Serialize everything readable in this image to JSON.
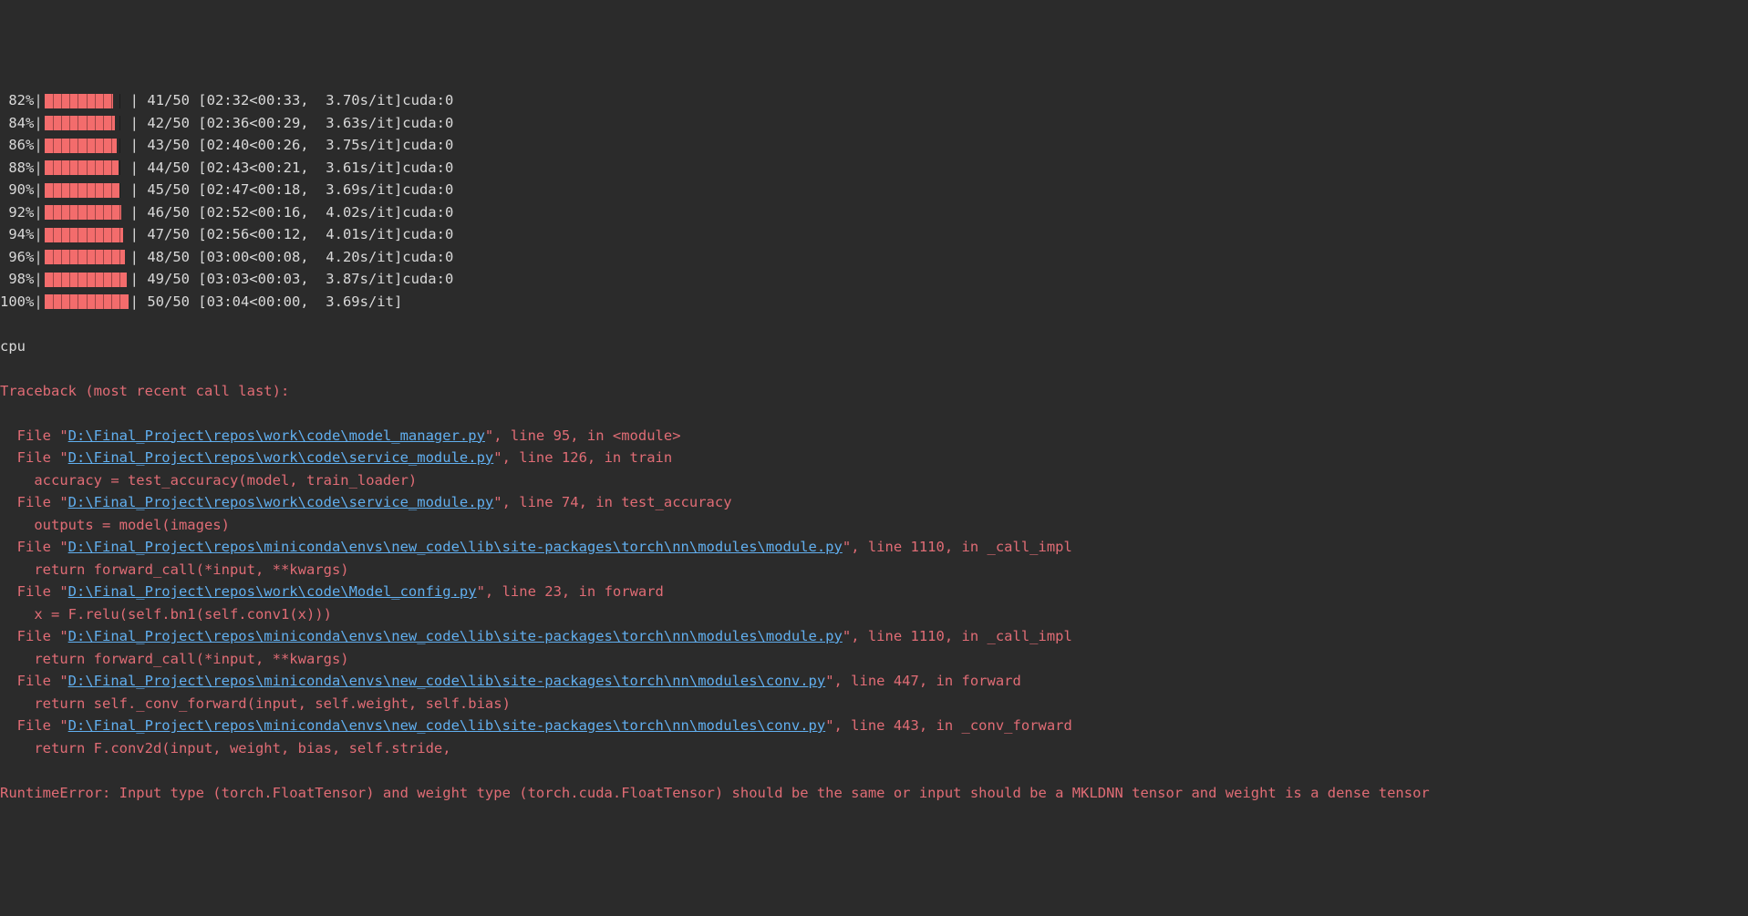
{
  "bar": {
    "ticks": 10
  },
  "progress": [
    {
      "pct": "82%",
      "fill": 82,
      "after": "| 41/50 [02:32<00:33,  3.70s/it]",
      "device": "cuda:0"
    },
    {
      "pct": "84%",
      "fill": 84,
      "after": "| 42/50 [02:36<00:29,  3.63s/it]",
      "device": "cuda:0"
    },
    {
      "pct": "86%",
      "fill": 86,
      "after": "| 43/50 [02:40<00:26,  3.75s/it]",
      "device": "cuda:0"
    },
    {
      "pct": "88%",
      "fill": 88,
      "after": "| 44/50 [02:43<00:21,  3.61s/it]",
      "device": "cuda:0"
    },
    {
      "pct": "90%",
      "fill": 90,
      "after": "| 45/50 [02:47<00:18,  3.69s/it]",
      "device": "cuda:0"
    },
    {
      "pct": "92%",
      "fill": 92,
      "after": "| 46/50 [02:52<00:16,  4.02s/it]",
      "device": "cuda:0"
    },
    {
      "pct": "94%",
      "fill": 94,
      "after": "| 47/50 [02:56<00:12,  4.01s/it]",
      "device": "cuda:0"
    },
    {
      "pct": "96%",
      "fill": 96,
      "after": "| 48/50 [03:00<00:08,  4.20s/it]",
      "device": "cuda:0"
    },
    {
      "pct": "98%",
      "fill": 98,
      "after": "| 49/50 [03:03<00:03,  3.87s/it]",
      "device": "cuda:0"
    },
    {
      "pct": "100%",
      "fill": 100,
      "after": "| 50/50 [03:04<00:00,  3.69s/it]",
      "device": ""
    }
  ],
  "cpu_line": "cpu",
  "traceback_header": "Traceback (most recent call last):",
  "frames": [
    {
      "prefix": "  File \"",
      "path": "D:\\Final_Project\\repos\\work\\code\\model_manager.py",
      "suffix": "\", line 95, in <module>",
      "code": ""
    },
    {
      "prefix": "  File \"",
      "path": "D:\\Final_Project\\repos\\work\\code\\service_module.py",
      "suffix": "\", line 126, in train",
      "code": "    accuracy = test_accuracy(model, train_loader)"
    },
    {
      "prefix": "  File \"",
      "path": "D:\\Final_Project\\repos\\work\\code\\service_module.py",
      "suffix": "\", line 74, in test_accuracy",
      "code": "    outputs = model(images)"
    },
    {
      "prefix": "  File \"",
      "path": "D:\\Final_Project\\repos\\miniconda\\envs\\new_code\\lib\\site-packages\\torch\\nn\\modules\\module.py",
      "suffix": "\", line 1110, in _call_impl",
      "code": "    return forward_call(*input, **kwargs)"
    },
    {
      "prefix": "  File \"",
      "path": "D:\\Final_Project\\repos\\work\\code\\Model_config.py",
      "suffix": "\", line 23, in forward",
      "code": "    x = F.relu(self.bn1(self.conv1(x)))"
    },
    {
      "prefix": "  File \"",
      "path": "D:\\Final_Project\\repos\\miniconda\\envs\\new_code\\lib\\site-packages\\torch\\nn\\modules\\module.py",
      "suffix": "\", line 1110, in _call_impl",
      "code": "    return forward_call(*input, **kwargs)"
    },
    {
      "prefix": "  File \"",
      "path": "D:\\Final_Project\\repos\\miniconda\\envs\\new_code\\lib\\site-packages\\torch\\nn\\modules\\conv.py",
      "suffix": "\", line 447, in forward",
      "code": "    return self._conv_forward(input, self.weight, self.bias)"
    },
    {
      "prefix": "  File \"",
      "path": "D:\\Final_Project\\repos\\miniconda\\envs\\new_code\\lib\\site-packages\\torch\\nn\\modules\\conv.py",
      "suffix": "\", line 443, in _conv_forward",
      "code": "    return F.conv2d(input, weight, bias, self.stride,"
    }
  ],
  "error_line": "RuntimeError: Input type (torch.FloatTensor) and weight type (torch.cuda.FloatTensor) should be the same or input should be a MKLDNN tensor and weight is a dense tensor"
}
